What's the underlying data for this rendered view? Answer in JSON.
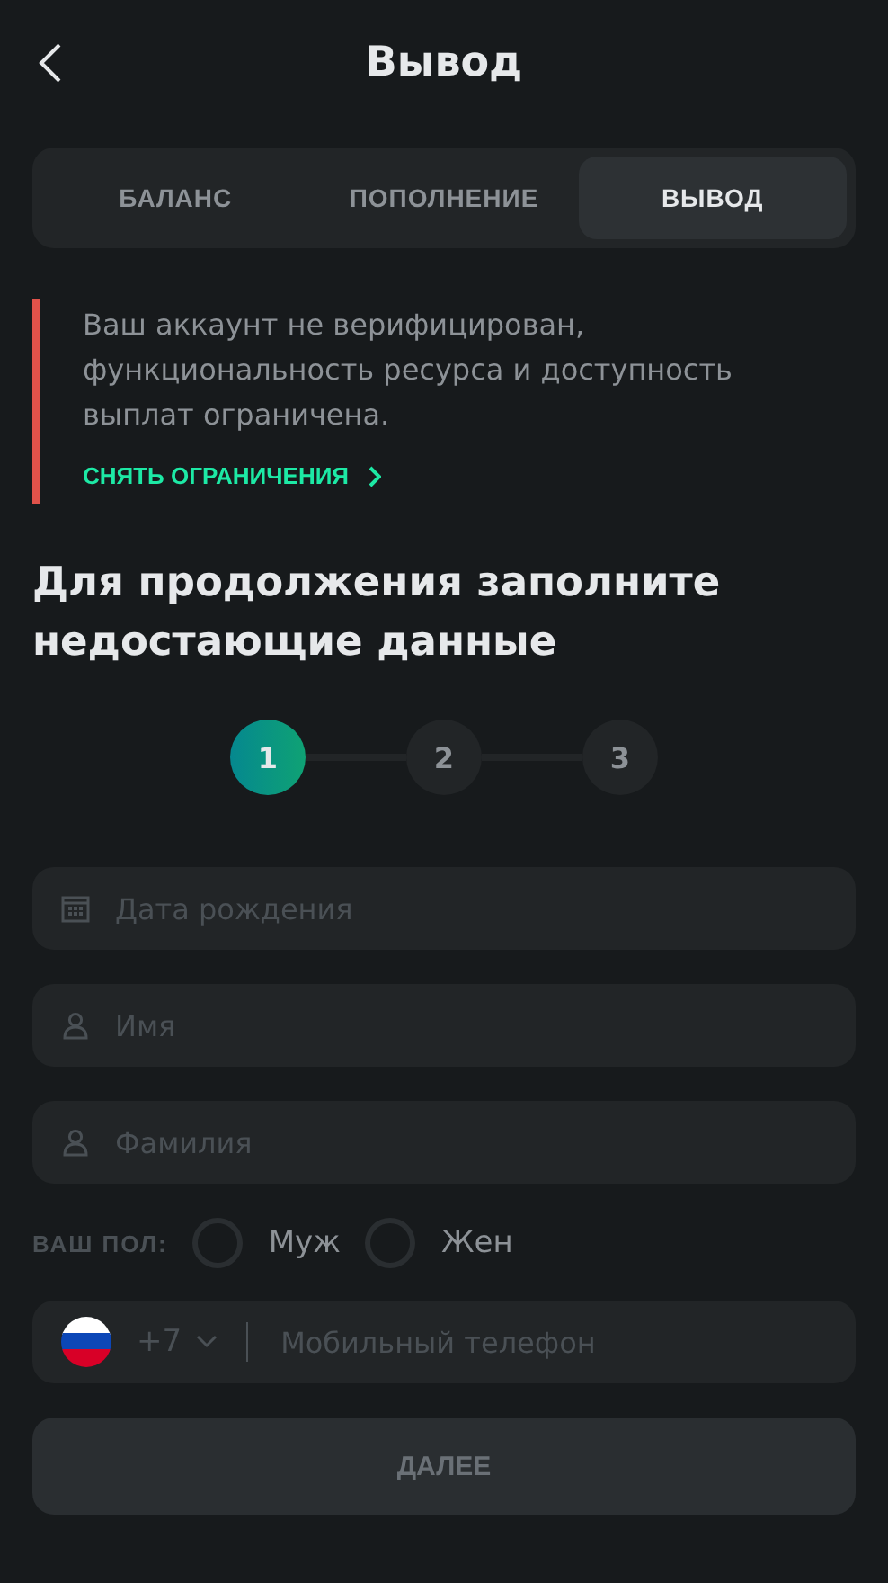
{
  "header": {
    "title": "Вывод"
  },
  "tabs": [
    {
      "label": "БАЛАНС",
      "selected": false
    },
    {
      "label": "ПОПОЛНЕНИЕ",
      "selected": false
    },
    {
      "label": "ВЫВОД",
      "selected": true
    }
  ],
  "alert": {
    "message": "Ваш аккаунт не верифицирован, функциональность ресурса и доступность выплат ограничена.",
    "link": "СНЯТЬ ОГРАНИЧЕНИЯ"
  },
  "heading": "Для продолжения заполните недостающие данные",
  "steps": [
    {
      "label": "1",
      "selected": true
    },
    {
      "label": "2",
      "selected": false
    },
    {
      "label": "3",
      "selected": false
    }
  ],
  "fields": [
    {
      "kind": "date",
      "placeholder": "Дата рождения"
    },
    {
      "kind": "person",
      "placeholder": "Имя"
    },
    {
      "kind": "person",
      "placeholder": "Фамилия"
    }
  ],
  "gender": {
    "label": "ВАШ ПОЛ:",
    "options": [
      {
        "label": "Муж",
        "selected": false
      },
      {
        "label": "Жен",
        "selected": false
      }
    ]
  },
  "phone": {
    "code": "+7",
    "placeholder": "Мобильный телефон"
  },
  "submit": {
    "label": "ДАЛЕЕ",
    "disabled": true
  }
}
